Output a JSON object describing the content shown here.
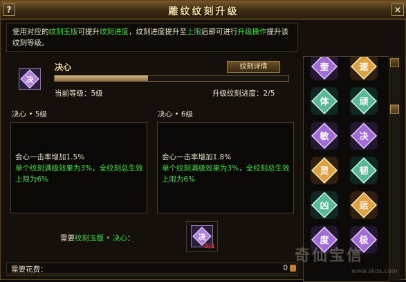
{
  "window": {
    "title": "雕纹纹刻升级",
    "help_label": "?",
    "close_label": "×"
  },
  "intro": {
    "p1": "使用对应的",
    "k1": "纹刻玉版",
    "p2": "可提升",
    "k2": "纹刻进度",
    "p3": "，纹刻进度提升至",
    "k3": "上限",
    "p4": "后即可进行",
    "k4": "升级操作",
    "p5": "提升该纹刻等级。"
  },
  "rune": {
    "name": "决心",
    "icon_char": "决",
    "detail_button": "纹刻详情",
    "current_level": "当前等级：5级",
    "progress_text": "升级纹刻进度：2/5",
    "progress": {
      "current": 2,
      "max": 5
    }
  },
  "levels": {
    "left": {
      "title": "决心 • 5级",
      "line1": "会心一击率增加1.5%",
      "line2": "单个纹刻满级效果为3%，全纹刻总生效上限为6%"
    },
    "right": {
      "title": "决心 • 6级",
      "line1": "会心一击率增加1.8%",
      "line2": "单个纹刻满级效果为3%，全纹刻总生效上限为6%"
    }
  },
  "requirement": {
    "prefix": "需要",
    "item": "纹刻玉版 • 决心",
    "suffix": "：",
    "icon_char": "决",
    "count": "0/1"
  },
  "cost": {
    "label": "需要花费：",
    "value": "0"
  },
  "rune_list": {
    "gems": [
      {
        "char": "奎",
        "color": "purple"
      },
      {
        "char": "速",
        "color": "orange"
      },
      {
        "char": "体",
        "color": "green"
      },
      {
        "char": "顽",
        "color": "green"
      },
      {
        "char": "敏",
        "color": "purple"
      },
      {
        "char": "决",
        "color": "purple"
      },
      {
        "char": "灵",
        "color": "orange"
      },
      {
        "char": "韧",
        "color": "green"
      },
      {
        "char": "凶",
        "color": "green"
      },
      {
        "char": "运",
        "color": "orange"
      },
      {
        "char": "度",
        "color": "purple"
      },
      {
        "char": "极",
        "color": "purple"
      }
    ]
  },
  "watermark": {
    "text": "奇仙宝信",
    "url": "www.skds.com"
  }
}
